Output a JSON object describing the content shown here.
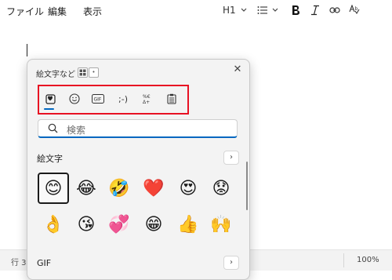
{
  "menu": {
    "file": "ファイル",
    "edit": "編集",
    "view": "表示"
  },
  "toolbar": {
    "heading_label": "H1"
  },
  "status": {
    "line": "行 3、",
    "zoom": "100%"
  },
  "emoji_panel": {
    "title": "絵文字など",
    "tabs": {
      "emoji": "♥",
      "kaomoji": ";-)",
      "gif": "GIF"
    },
    "search_placeholder": "検索",
    "section_emoji": "絵文字",
    "section_gif": "GIF",
    "more_glyph": "›",
    "close_glyph": "✕",
    "emojis": [
      "😊",
      "😂",
      "🤣",
      "❤️",
      "😍",
      "😟",
      "👌",
      "😘",
      "💞",
      "😁",
      "👍",
      "🙌"
    ]
  },
  "colors": {
    "accent": "#0067c0",
    "highlight": "#e81123"
  },
  "icons": [
    "chevron-down-icon",
    "list-icon",
    "bold-icon",
    "italic-icon",
    "link-icon",
    "spellcheck-icon",
    "grid-icon",
    "close-icon",
    "search-icon",
    "chevron-right-icon"
  ]
}
